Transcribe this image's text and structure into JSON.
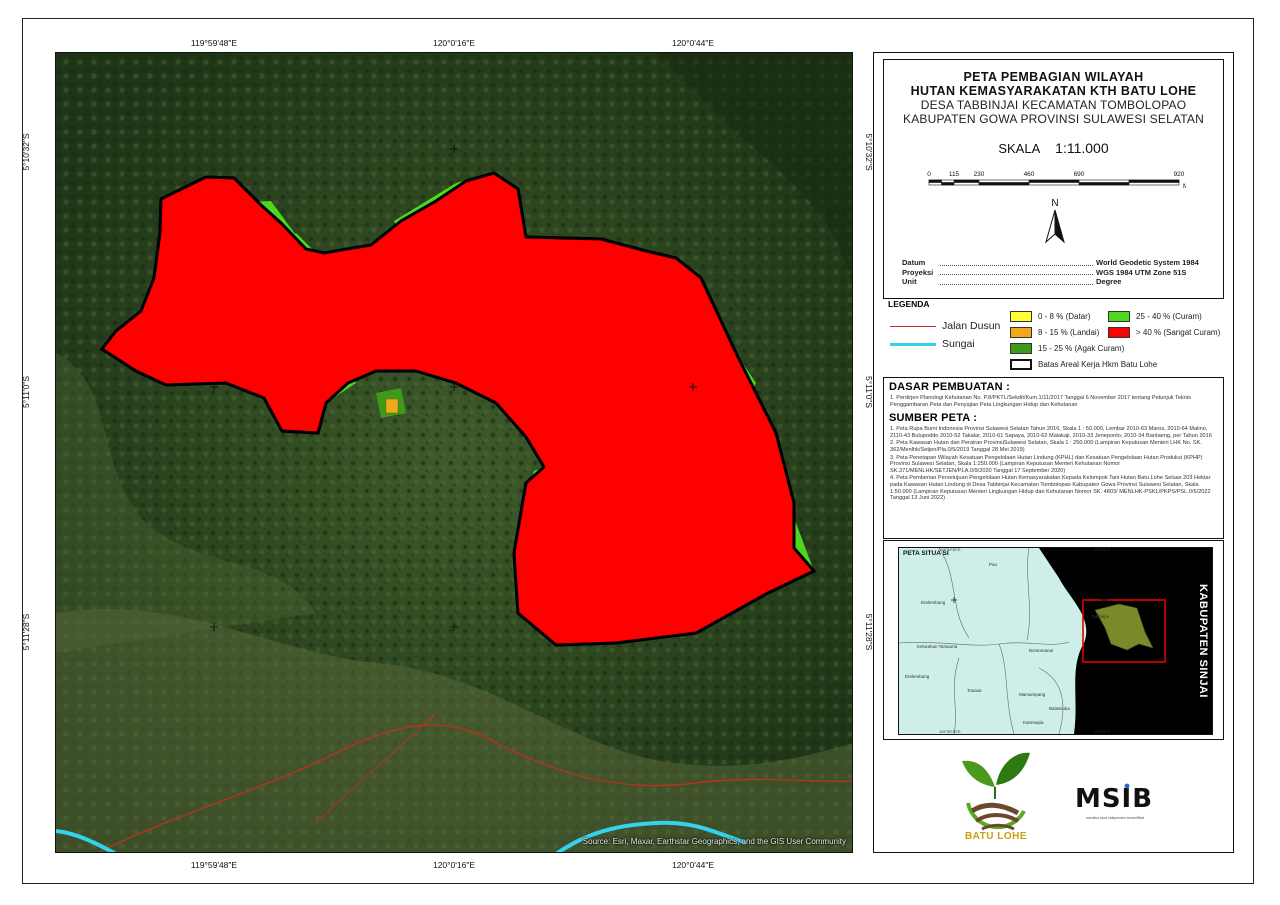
{
  "map": {
    "coords_top": [
      "119°59'48\"E",
      "120°0'16\"E",
      "120°0'44\"E"
    ],
    "coords_bottom": [
      "119°59'48\"E",
      "120°0'16\"E",
      "120°0'44\"E"
    ],
    "coords_left": [
      "5°10'32\"S",
      "5°11'0\"S",
      "5°11'28\"S"
    ],
    "coords_right": [
      "5°10'32\"S",
      "5°11'0\"S",
      "5°11'28\"S"
    ],
    "attribution": "Source: Esri, Maxar, Earthstar Geographics, and the GIS User Community",
    "colors": {
      "slope_0_8": "#ffff33",
      "slope_8_15": "#f0a81c",
      "slope_15_25": "#3d9a1b",
      "slope_25_40": "#4fd61e",
      "slope_gt_40": "#ff0000",
      "jalan_dusun": "#b8321e",
      "sungai": "#35d2ee"
    }
  },
  "title": {
    "line1": "PETA PEMBAGIAN WILAYAH",
    "line2": "HUTAN KEMASYARAKATAN KTH BATU LOHE",
    "sub1": "DESA TABBINJAI KECAMATAN TOMBOLOPAO",
    "sub2": "KABUPATEN GOWA PROVINSI SULAWESI SELATAN"
  },
  "scale": {
    "label": "SKALA",
    "value": "1:11.000",
    "ticks": [
      "0",
      "115",
      "230",
      "460",
      "690",
      "920"
    ],
    "unit": "M"
  },
  "north_label": "N",
  "meta": [
    {
      "key": "Datum",
      "value": "World Geodetic System 1984"
    },
    {
      "key": "Proyeksi",
      "value": "WGS 1984 UTM Zone 51S"
    },
    {
      "key": "Unit",
      "value": "Degree"
    }
  ],
  "legend": {
    "title": "LEGENDA",
    "jalan": "Jalan Dusun",
    "sungai": "Sungai",
    "slope_0_8": "0 - 8 % (Datar)",
    "slope_8_15": "8 - 15 % (Landai)",
    "slope_15_25": "15 - 25 % (Agak Curam)",
    "slope_25_40": "25 - 40 % (Curam)",
    "slope_gt_40": "> 40 % (Sangat Curam)",
    "batas": "Batas Areal Kerja Hkm Batu Lohe"
  },
  "dasar": {
    "heading": "DASAR PEMBUATAN :",
    "items": [
      "1. Perdirjen Planologi Kehutanan No. P.8/PKTL/Sekdit/Kum.1/11/2017 Tanggal 6 November 2017 tentang Petunjuk Teknis Penggambaran Peta dan Penyajian Peta Lingkungan Hidup dan Kehutanan"
    ]
  },
  "sumber": {
    "heading": "SUMBER PETA :",
    "items": [
      "1. Peta Rupa Bumi Indonesia Provinsi Sulawesi Selatan Tahun 2016, Skala 1 : 50.000, Lembar 2010-63 Maros, 2010-64 Malino, 2110-43 Bulupoddo 2010-52 Takalar, 2010-61 Sapaya, 2010-62 Malakaji, 2010-33 Jeneponto, 2010-34 Bantaeng, per Tahun 2016",
      "2. Peta Kawasan Hutan dan Perairan ProvinsiSulawesi Selatan, Skala 1 : 250.000 (Lampiran Keputusan Menteri LHK No. SK. 362/Menlhk/Setjen/Pla.0/5/2019 Tanggal 28 Mei 2019)",
      "3. Peta Penetapan Wilayah Kesatuan Pengelolaan Hutan Lindung (KPHL) dan Kesatuan Pengelolaan Hutan Produksi (KPHP) Provinsi Sulawesi Selatan, Skala 1:250.000 (Lampiran Keputusan Menteri Kehutanan Nomor SK.371/MENLHK/SETJEN/PLA.0/9/2020 Tanggal 17 September 2020)",
      "4. Peta Pemberian Persetujuan Pengelolaan Hutan Kemasyarakatan Kepada Kelompok Tani Hutan Batu Lohe Seluas 203 Hektar pada Kawasan Hutan Lindung di Desa Tabbinjai Kecamatan Tombolopao Kabupaten Gowa Provinsi Sulawesi Selatan, Skala 1:50.000 (Lampiran Keputusan Menteri Lingkungan Hidup dan Kehutanan Nomor SK. 4803/ MENLHK-PSKL/PKPS/PSL.0/6/2022 Tanggal 13 Juni 2022)"
    ]
  },
  "inset": {
    "title": "PETA SITUA SI",
    "kabupaten": "KABUPATEN SINJAI",
    "places": [
      "Pao",
      "Erelembang",
      "Kelurahan Tamaona",
      "Tabbinjai",
      "Bontomanai",
      "Tonasa",
      "Mamampang",
      "Balassuka",
      "Kanreapia",
      "Erelembang"
    ],
    "ticks": [
      "119°59'30\"E",
      "120°0'0\"E",
      "119°59'30\"E",
      "120°0'0\"E"
    ]
  },
  "logos": {
    "batu_lohe": "BATU   LOHE",
    "msib": "MSIB",
    "msib_caption": "merdeka studi independen bersertifikat"
  }
}
